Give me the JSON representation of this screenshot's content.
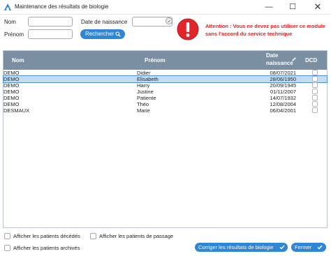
{
  "window": {
    "title": "Maintenance des résultats de biologie",
    "minimize_glyph": "—",
    "maximize_glyph": "☐",
    "close_glyph": "✕"
  },
  "search": {
    "nom_label": "Nom",
    "nom_value": "",
    "prenom_label": "Prénom",
    "prenom_value": "",
    "date_label": "Date de naissance",
    "date_value": "",
    "button_label": "Rechercher"
  },
  "warning": {
    "icon": "exclamation-icon",
    "text": "Attention : Vous ne devez pas utiliser ce module sans l'accord du service technique",
    "color": "#e0262b"
  },
  "table": {
    "columns": {
      "nom": "Nom",
      "prenom": "Prénom",
      "date_line1": "Date",
      "date_line2": "naissance",
      "dcd": "DCD"
    },
    "rows": [
      {
        "nom": "DEMO",
        "prenom": "Didier",
        "date": "08/07/2021",
        "dcd": false
      },
      {
        "nom": "DEMO",
        "prenom": "Elisabeth",
        "date": "28/06/1950",
        "dcd": false,
        "selected": true
      },
      {
        "nom": "DEMO",
        "prenom": "Harry",
        "date": "20/09/1945",
        "dcd": false
      },
      {
        "nom": "DEMO",
        "prenom": "Justine",
        "date": "01/11/2007",
        "dcd": false
      },
      {
        "nom": "DEMO",
        "prenom": "Patiente",
        "date": "14/07/1932",
        "dcd": false
      },
      {
        "nom": "DEMO",
        "prenom": "Théo",
        "date": "12/08/2004",
        "dcd": false
      },
      {
        "nom": "DESMAUX",
        "prenom": "Marie",
        "date": "06/04/2001",
        "dcd": false
      }
    ]
  },
  "options": {
    "show_deceased": "Afficher les patients décédés",
    "show_passage": "Afficher les patients de passage",
    "show_archived": "Afficher les patients archivés"
  },
  "footer": {
    "correct_label": "Corriger les résultats de biologie",
    "close_label": "Fermer"
  },
  "colors": {
    "accent": "#2f86d6",
    "header": "#7b8fa3",
    "selection": "#c3dcf4"
  }
}
